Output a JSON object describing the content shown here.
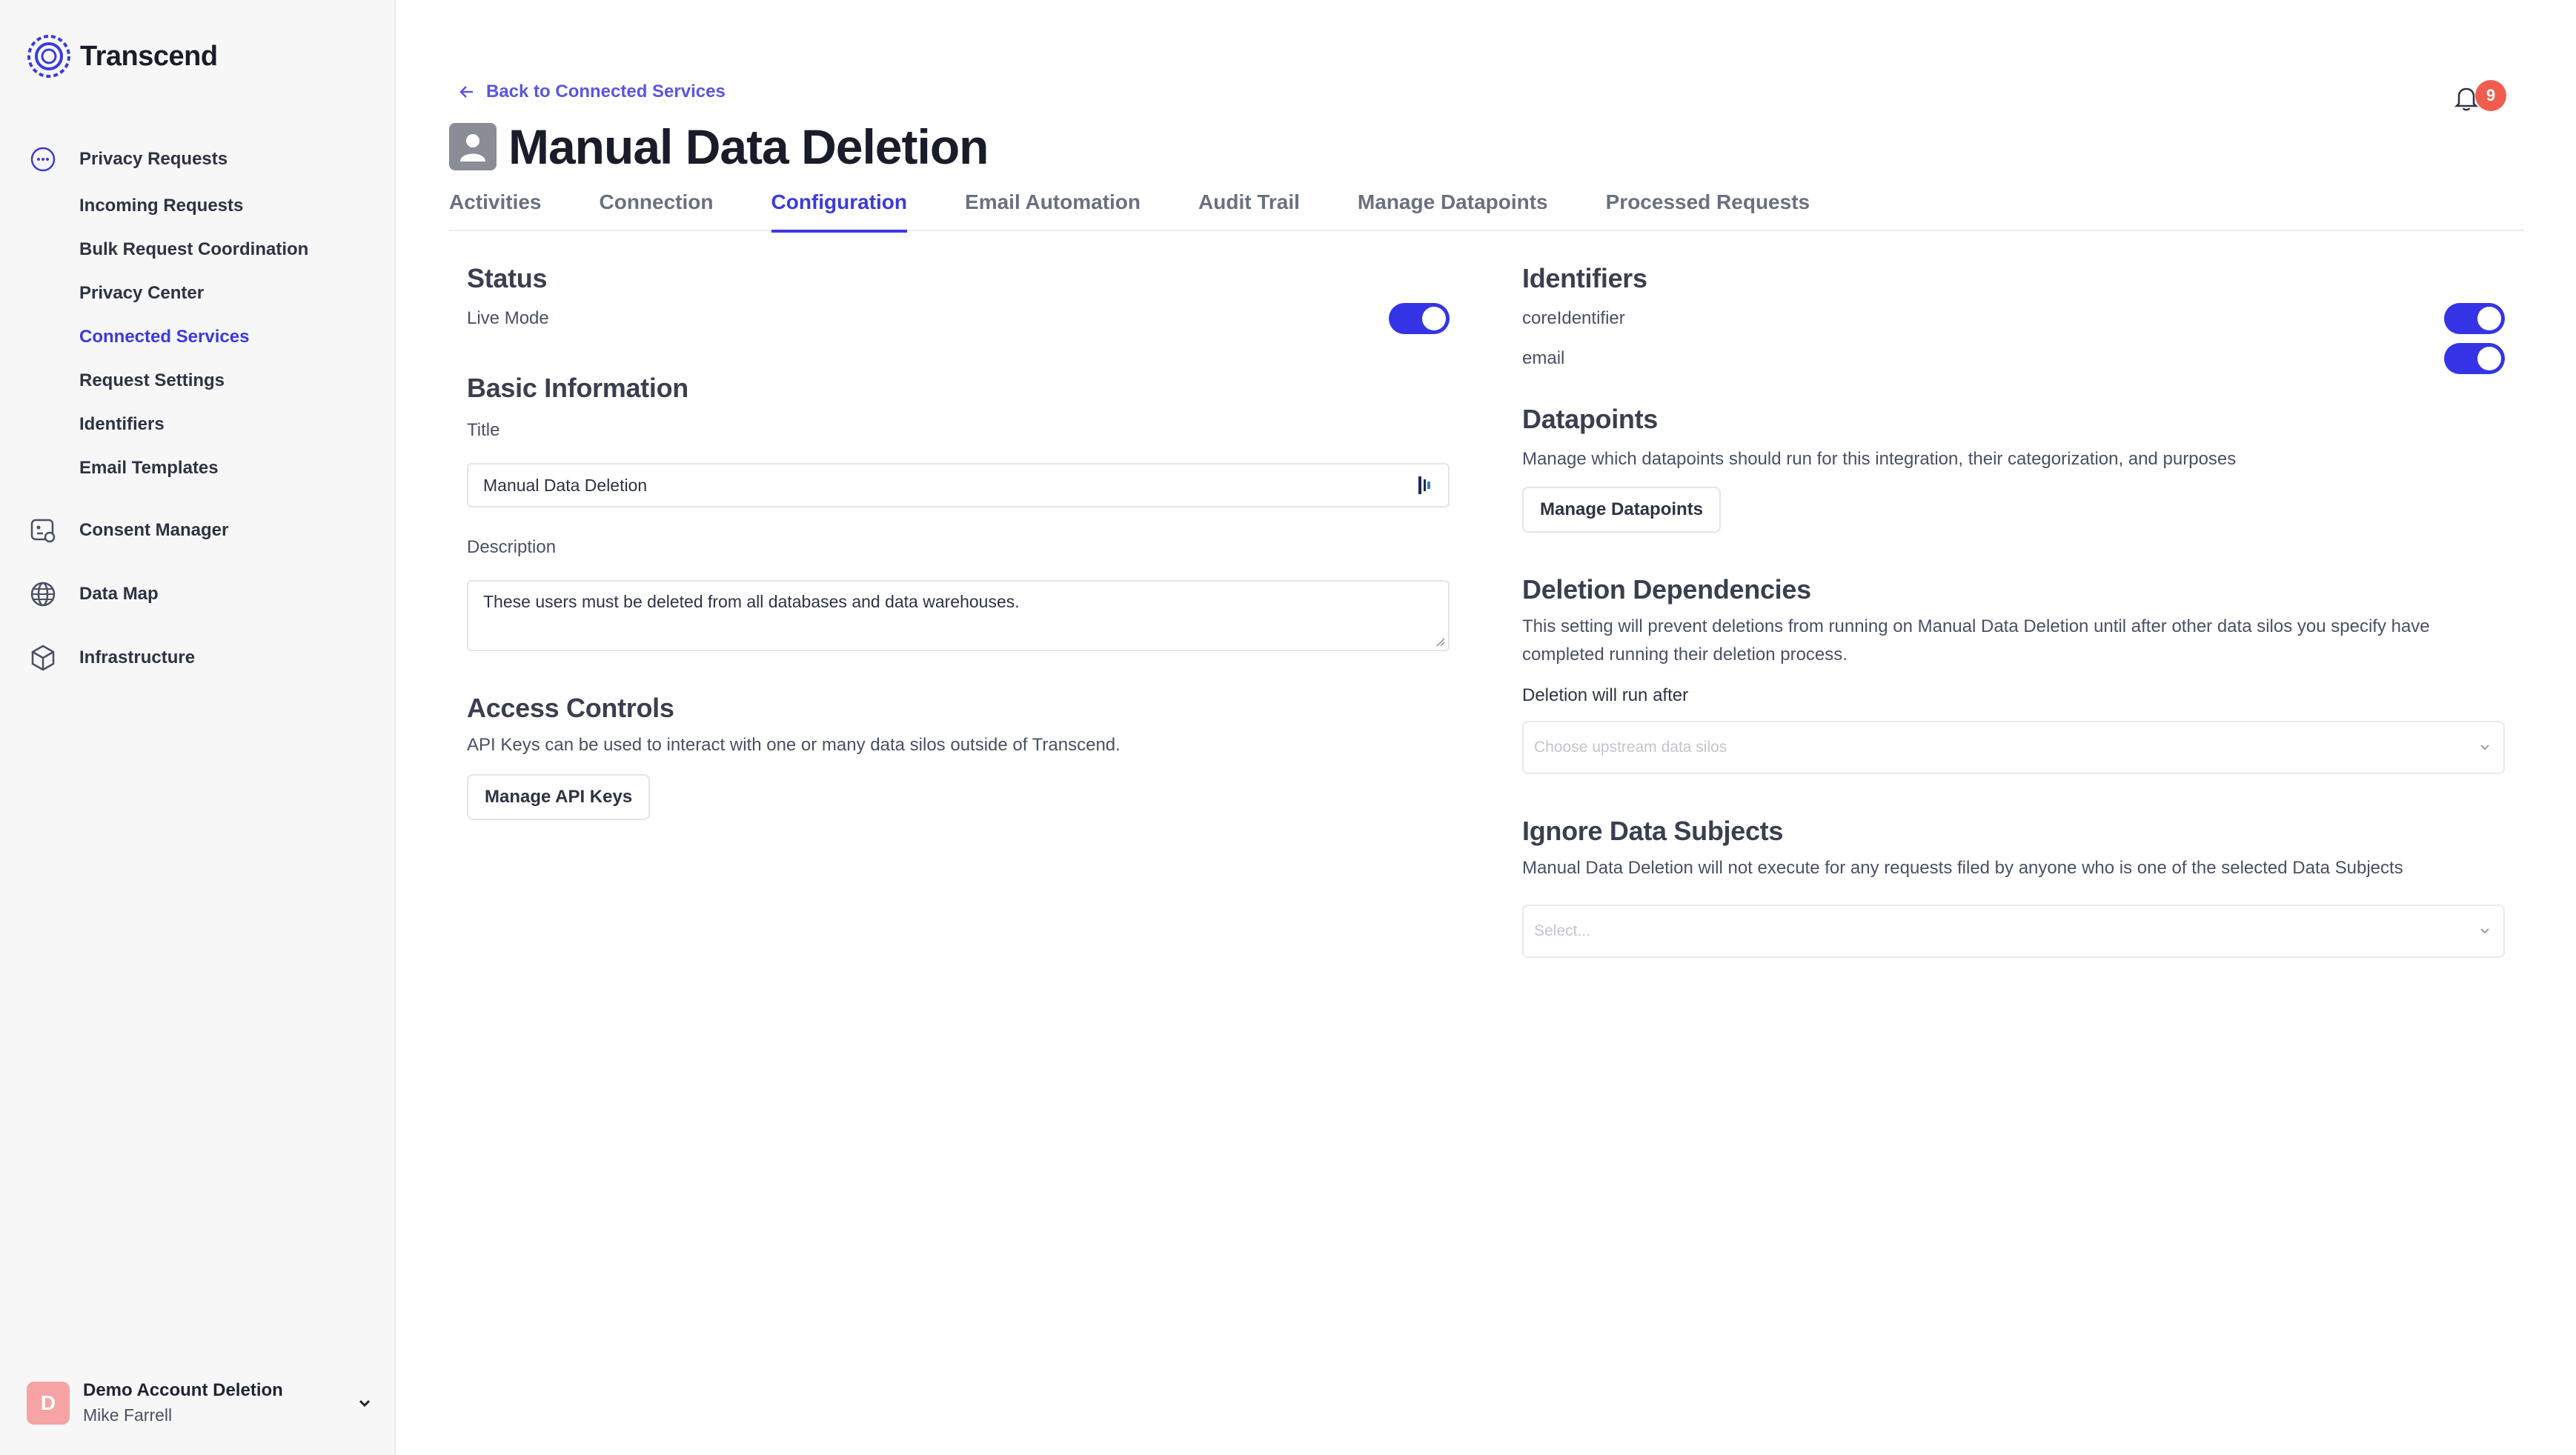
{
  "app": {
    "name": "Transcend"
  },
  "sidebar": {
    "groups": [
      {
        "label": "Privacy Requests",
        "icon": "chat-bubble-icon"
      },
      {
        "label": "Consent Manager",
        "icon": "consent-icon"
      },
      {
        "label": "Data Map",
        "icon": "globe-icon"
      },
      {
        "label": "Infrastructure",
        "icon": "cube-icon"
      }
    ],
    "privacy_sub": [
      "Incoming Requests",
      "Bulk Request Coordination",
      "Privacy Center",
      "Connected Services",
      "Request Settings",
      "Identifiers",
      "Email Templates"
    ],
    "account": {
      "initial": "D",
      "name": "Demo Account Deletion",
      "user": "Mike Farrell"
    }
  },
  "header": {
    "back_label": "Back to Connected Services",
    "title": "Manual Data Deletion",
    "notification_count": "9"
  },
  "tabs": [
    "Activities",
    "Connection",
    "Configuration",
    "Email Automation",
    "Audit Trail",
    "Manage Datapoints",
    "Processed Requests"
  ],
  "status": {
    "title": "Status",
    "live_mode_label": "Live Mode",
    "live_mode_on": true
  },
  "basic": {
    "title": "Basic Information",
    "title_label": "Title",
    "title_value": "Manual Data Deletion",
    "description_label": "Description",
    "description_value": "These users must be deleted from all databases and data warehouses."
  },
  "access": {
    "title": "Access Controls",
    "help": "API Keys can be used to interact with one or many data silos outside of Transcend.",
    "button": "Manage API Keys"
  },
  "identifiers": {
    "title": "Identifiers",
    "items": [
      {
        "label": "coreIdentifier",
        "on": true
      },
      {
        "label": "email",
        "on": true
      }
    ]
  },
  "datapoints": {
    "title": "Datapoints",
    "help": "Manage which datapoints should run for this integration, their categorization, and purposes",
    "button": "Manage Datapoints"
  },
  "deletion": {
    "title": "Deletion Dependencies",
    "help": "This setting will prevent deletions from running on Manual Data Deletion until after other data silos you specify have completed running their deletion process.",
    "run_after_label": "Deletion will run after",
    "placeholder": "Choose upstream data silos"
  },
  "ignore": {
    "title": "Ignore Data Subjects",
    "help": "Manual Data Deletion will not execute for any requests filed by anyone who is one of the selected Data Subjects",
    "placeholder": "Select..."
  },
  "colors": {
    "accent": "#3a3ae0",
    "toggle": "#3434e6",
    "badge": "#f05d4f",
    "avatar": "#f5a3a3"
  }
}
